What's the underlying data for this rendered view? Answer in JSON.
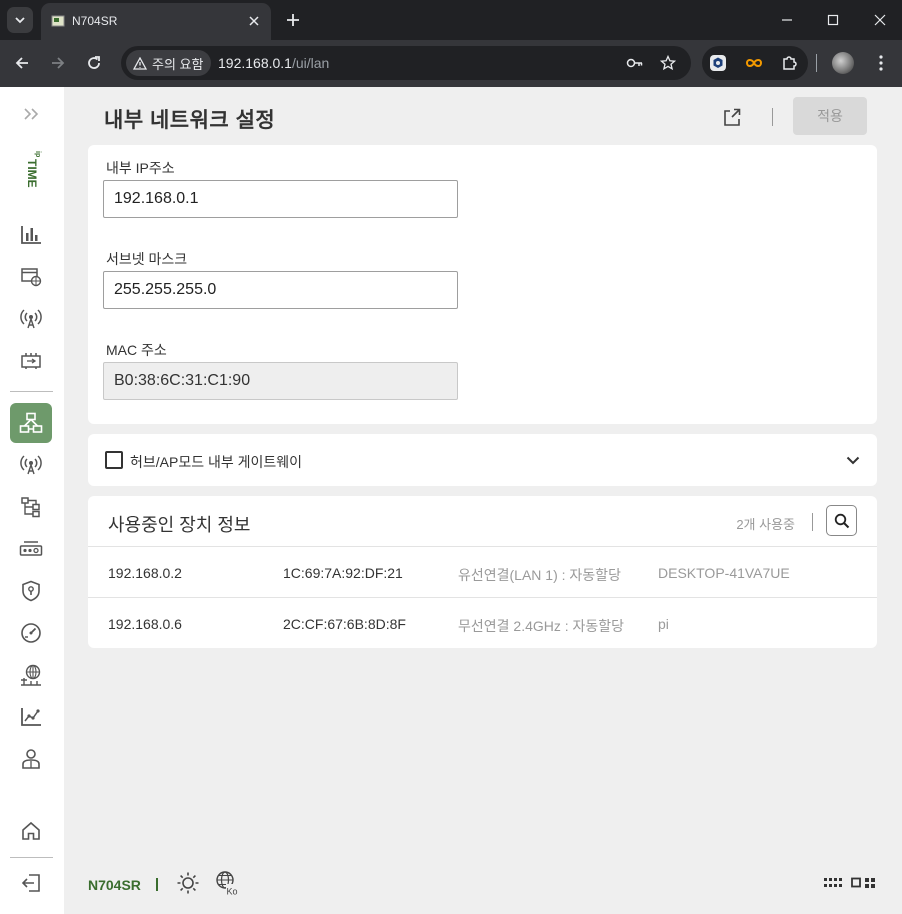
{
  "browser": {
    "tab_title": "N704SR",
    "security_chip": "주의 요함",
    "url_host": "192.168.0.1",
    "url_path": "/ui/lan"
  },
  "header": {
    "title": "내부 네트워크 설정",
    "apply_label": "적용"
  },
  "lan": {
    "ip": {
      "label": "내부 IP주소",
      "value": "192.168.0.1"
    },
    "subnet": {
      "label": "서브넷 마스크",
      "value": "255.255.255.0"
    },
    "mac": {
      "label": "MAC 주소",
      "value": "B0:38:6C:31:C1:90"
    }
  },
  "hub_mode": {
    "label": "허브/AP모드 내부 게이트웨이",
    "checked": false
  },
  "devices": {
    "title": "사용중인 장치 정보",
    "count_label": "2개 사용중",
    "rows": [
      {
        "ip": "192.168.0.2",
        "mac": "1C:69:7A:92:DF:21",
        "connection": "유선연결(LAN 1) : 자동할당",
        "name": "DESKTOP-41VA7UE"
      },
      {
        "ip": "192.168.0.6",
        "mac": "2C:CF:67:6B:8D:8F",
        "connection": "무선연결 2.4GHz : 자동할당",
        "name": "pi"
      }
    ]
  },
  "footer": {
    "brand": "N704SR",
    "lang_badge": "Ko"
  },
  "colors": {
    "brand_green": "#3a6d2e",
    "active_nav": "#6e9a6b"
  },
  "icons": {
    "sidebar": [
      "expand-icon",
      "bar-chart-icon",
      "web-browser-icon",
      "wireless-icon",
      "hardware-icon",
      "network-topology-icon",
      "wireless-settings-icon",
      "tree-icon",
      "router-icon",
      "security-shield-icon",
      "speedometer-icon",
      "globe-network-icon",
      "trend-chart-icon",
      "user-admin-icon",
      "home-icon",
      "logout-icon"
    ]
  }
}
